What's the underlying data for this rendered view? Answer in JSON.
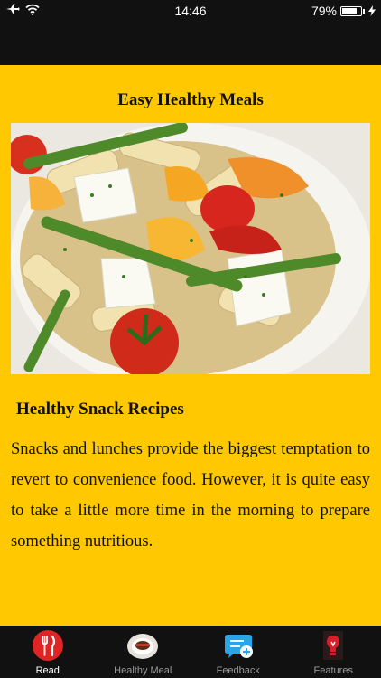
{
  "status": {
    "time": "14:46",
    "battery_percent": "79%",
    "battery_level": 0.79
  },
  "page": {
    "title": "Easy Healthy Meals",
    "image_icon": "food-photo-pasta-salad",
    "section_title": "Healthy Snack Recipes",
    "body": "Snacks and lunches provide the biggest temptation to revert to convenience food. However, it is quite easy to take a little more time in the morning to prepare something nutritious."
  },
  "tabs": [
    {
      "label": "Read",
      "icon": "fork-knife-icon",
      "active": true
    },
    {
      "label": "Healthy Meal",
      "icon": "meal-plate-icon",
      "active": false
    },
    {
      "label": "Feedback",
      "icon": "chat-plus-icon",
      "active": false
    },
    {
      "label": "Features",
      "icon": "lightbulb-icon",
      "active": false
    }
  ],
  "colors": {
    "background": "#ffc800",
    "bars": "#111111",
    "accent_red": "#e02424",
    "feedback_blue": "#2aa6e6"
  }
}
